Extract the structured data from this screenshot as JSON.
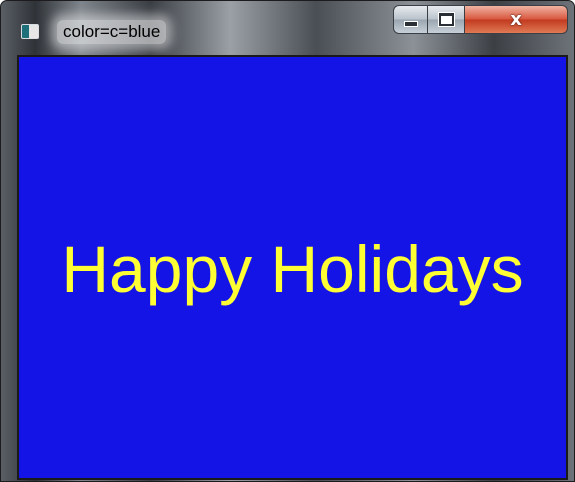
{
  "window": {
    "title": "color=c=blue",
    "icon": "app-window-icon",
    "buttons": {
      "minimize_icon": "minimize-icon",
      "maximize_icon": "maximize-icon",
      "close_icon": "close-icon",
      "close_glyph": "x"
    }
  },
  "content": {
    "message": "Happy Holidays",
    "background_color": "#1414e6",
    "text_color": "#ffff33"
  }
}
